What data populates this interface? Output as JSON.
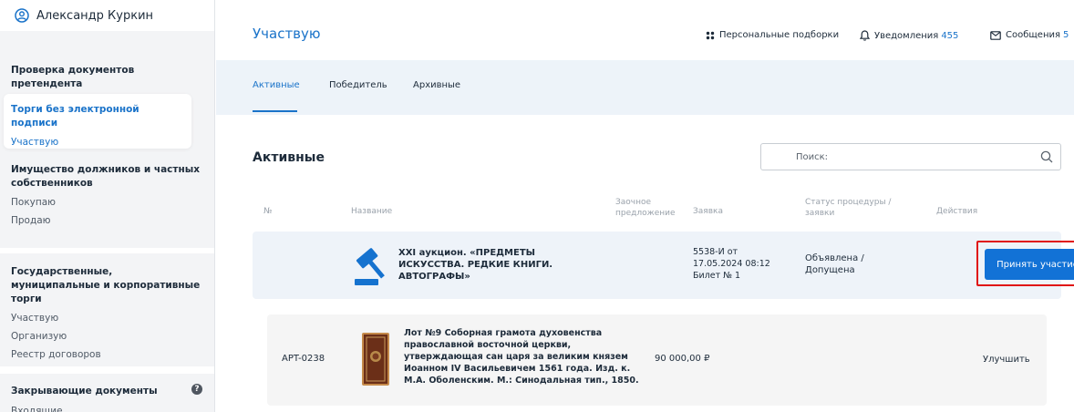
{
  "sidebar": {
    "user_name": "Александр Куркин",
    "blocks": [
      {
        "heading": "Проверка документов претендента",
        "items": []
      },
      {
        "heading": "Торги без электронной подписи",
        "items": [
          "Участвую"
        ]
      },
      {
        "heading": "Имущество должников и частных собственников",
        "items": [
          "Покупаю",
          "Продаю"
        ]
      },
      {
        "heading": "Государственные, муниципальные и корпоративные торги",
        "items": [
          "Участвую",
          "Организую",
          "Реестр договоров"
        ]
      },
      {
        "heading": "Закрывающие документы",
        "items": [
          "Входящие"
        ]
      }
    ]
  },
  "header": {
    "title": "Участвую",
    "links": {
      "collections": "Персональные подборки",
      "notifications": "Уведомления",
      "notifications_count": "455",
      "messages": "Сообщения",
      "messages_count": "5"
    }
  },
  "tabs": [
    "Активные",
    "Победитель",
    "Архивные"
  ],
  "section": {
    "title": "Активные",
    "search_placeholder": "Поиск:"
  },
  "table": {
    "columns": [
      "№",
      "Название",
      "Заочное предложение",
      "Заявка",
      "Статус процедуры / заявки",
      "Действия"
    ],
    "auction": {
      "title": "XXI аукцион. «ПРЕДМЕТЫ ИСКУССТВА. РЕДКИЕ КНИГИ. АВТОГРАФЫ»",
      "bid_line1": "5538-И от",
      "bid_line2": "17.05.2024 08:12",
      "bid_line3": "Билет № 1",
      "status_line1": "Объявлена /",
      "status_line2": "Допущена",
      "action": "Принять участие"
    },
    "lot": {
      "code": "APT-0238",
      "title": "Лот №9 Соборная грамота духовенства православной восточной церкви, утверждающая сан царя за великим князем Иоанном IV Васильевичем 1561 года. Изд. к. М.А. Оболенским. М.: Синодальная тип., 1850.",
      "price": "90 000,00 ₽",
      "action": "Улучшить"
    }
  },
  "colors": {
    "accent": "#1a73c9",
    "button": "#1272d6",
    "highlight_border": "#e01313"
  }
}
